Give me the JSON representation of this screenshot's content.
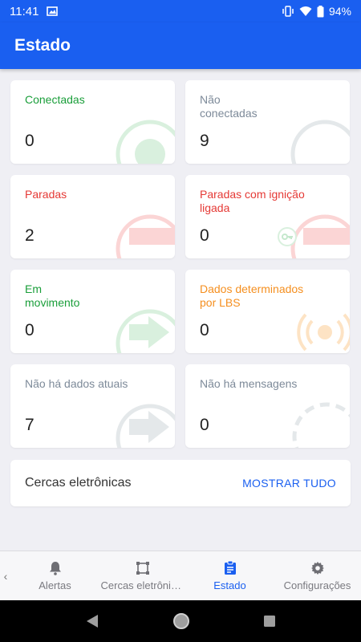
{
  "status_bar": {
    "time": "11:41",
    "battery": "94%"
  },
  "app_bar": {
    "title": "Estado"
  },
  "cards": [
    {
      "label": "Conectadas",
      "value": "0"
    },
    {
      "label": "Não conectadas",
      "value": "9"
    },
    {
      "label": "Paradas",
      "value": "2"
    },
    {
      "label": "Paradas com ignição ligada",
      "value": "0"
    },
    {
      "label": "Em movimento",
      "value": "0"
    },
    {
      "label": "Dados determinados por LBS",
      "value": "0"
    },
    {
      "label": "Não há dados atuais",
      "value": "7"
    },
    {
      "label": "Não há mensagens",
      "value": "0"
    }
  ],
  "fences": {
    "title": "Cercas eletrônicas",
    "show_all": "MOSTRAR TUDO"
  },
  "bottom_nav": [
    {
      "label": "Alertas",
      "icon": "bell-icon"
    },
    {
      "label": "Cercas eletrônicas",
      "icon": "geofence-icon"
    },
    {
      "label": "Estado",
      "icon": "clipboard-icon",
      "active": true
    },
    {
      "label": "Configurações",
      "icon": "gear-icon"
    }
  ],
  "colors": {
    "primary": "#1a5ff0",
    "green": "#1a9e3a",
    "red": "#e53935",
    "orange": "#f58f1f",
    "gray": "#7d8a99"
  }
}
